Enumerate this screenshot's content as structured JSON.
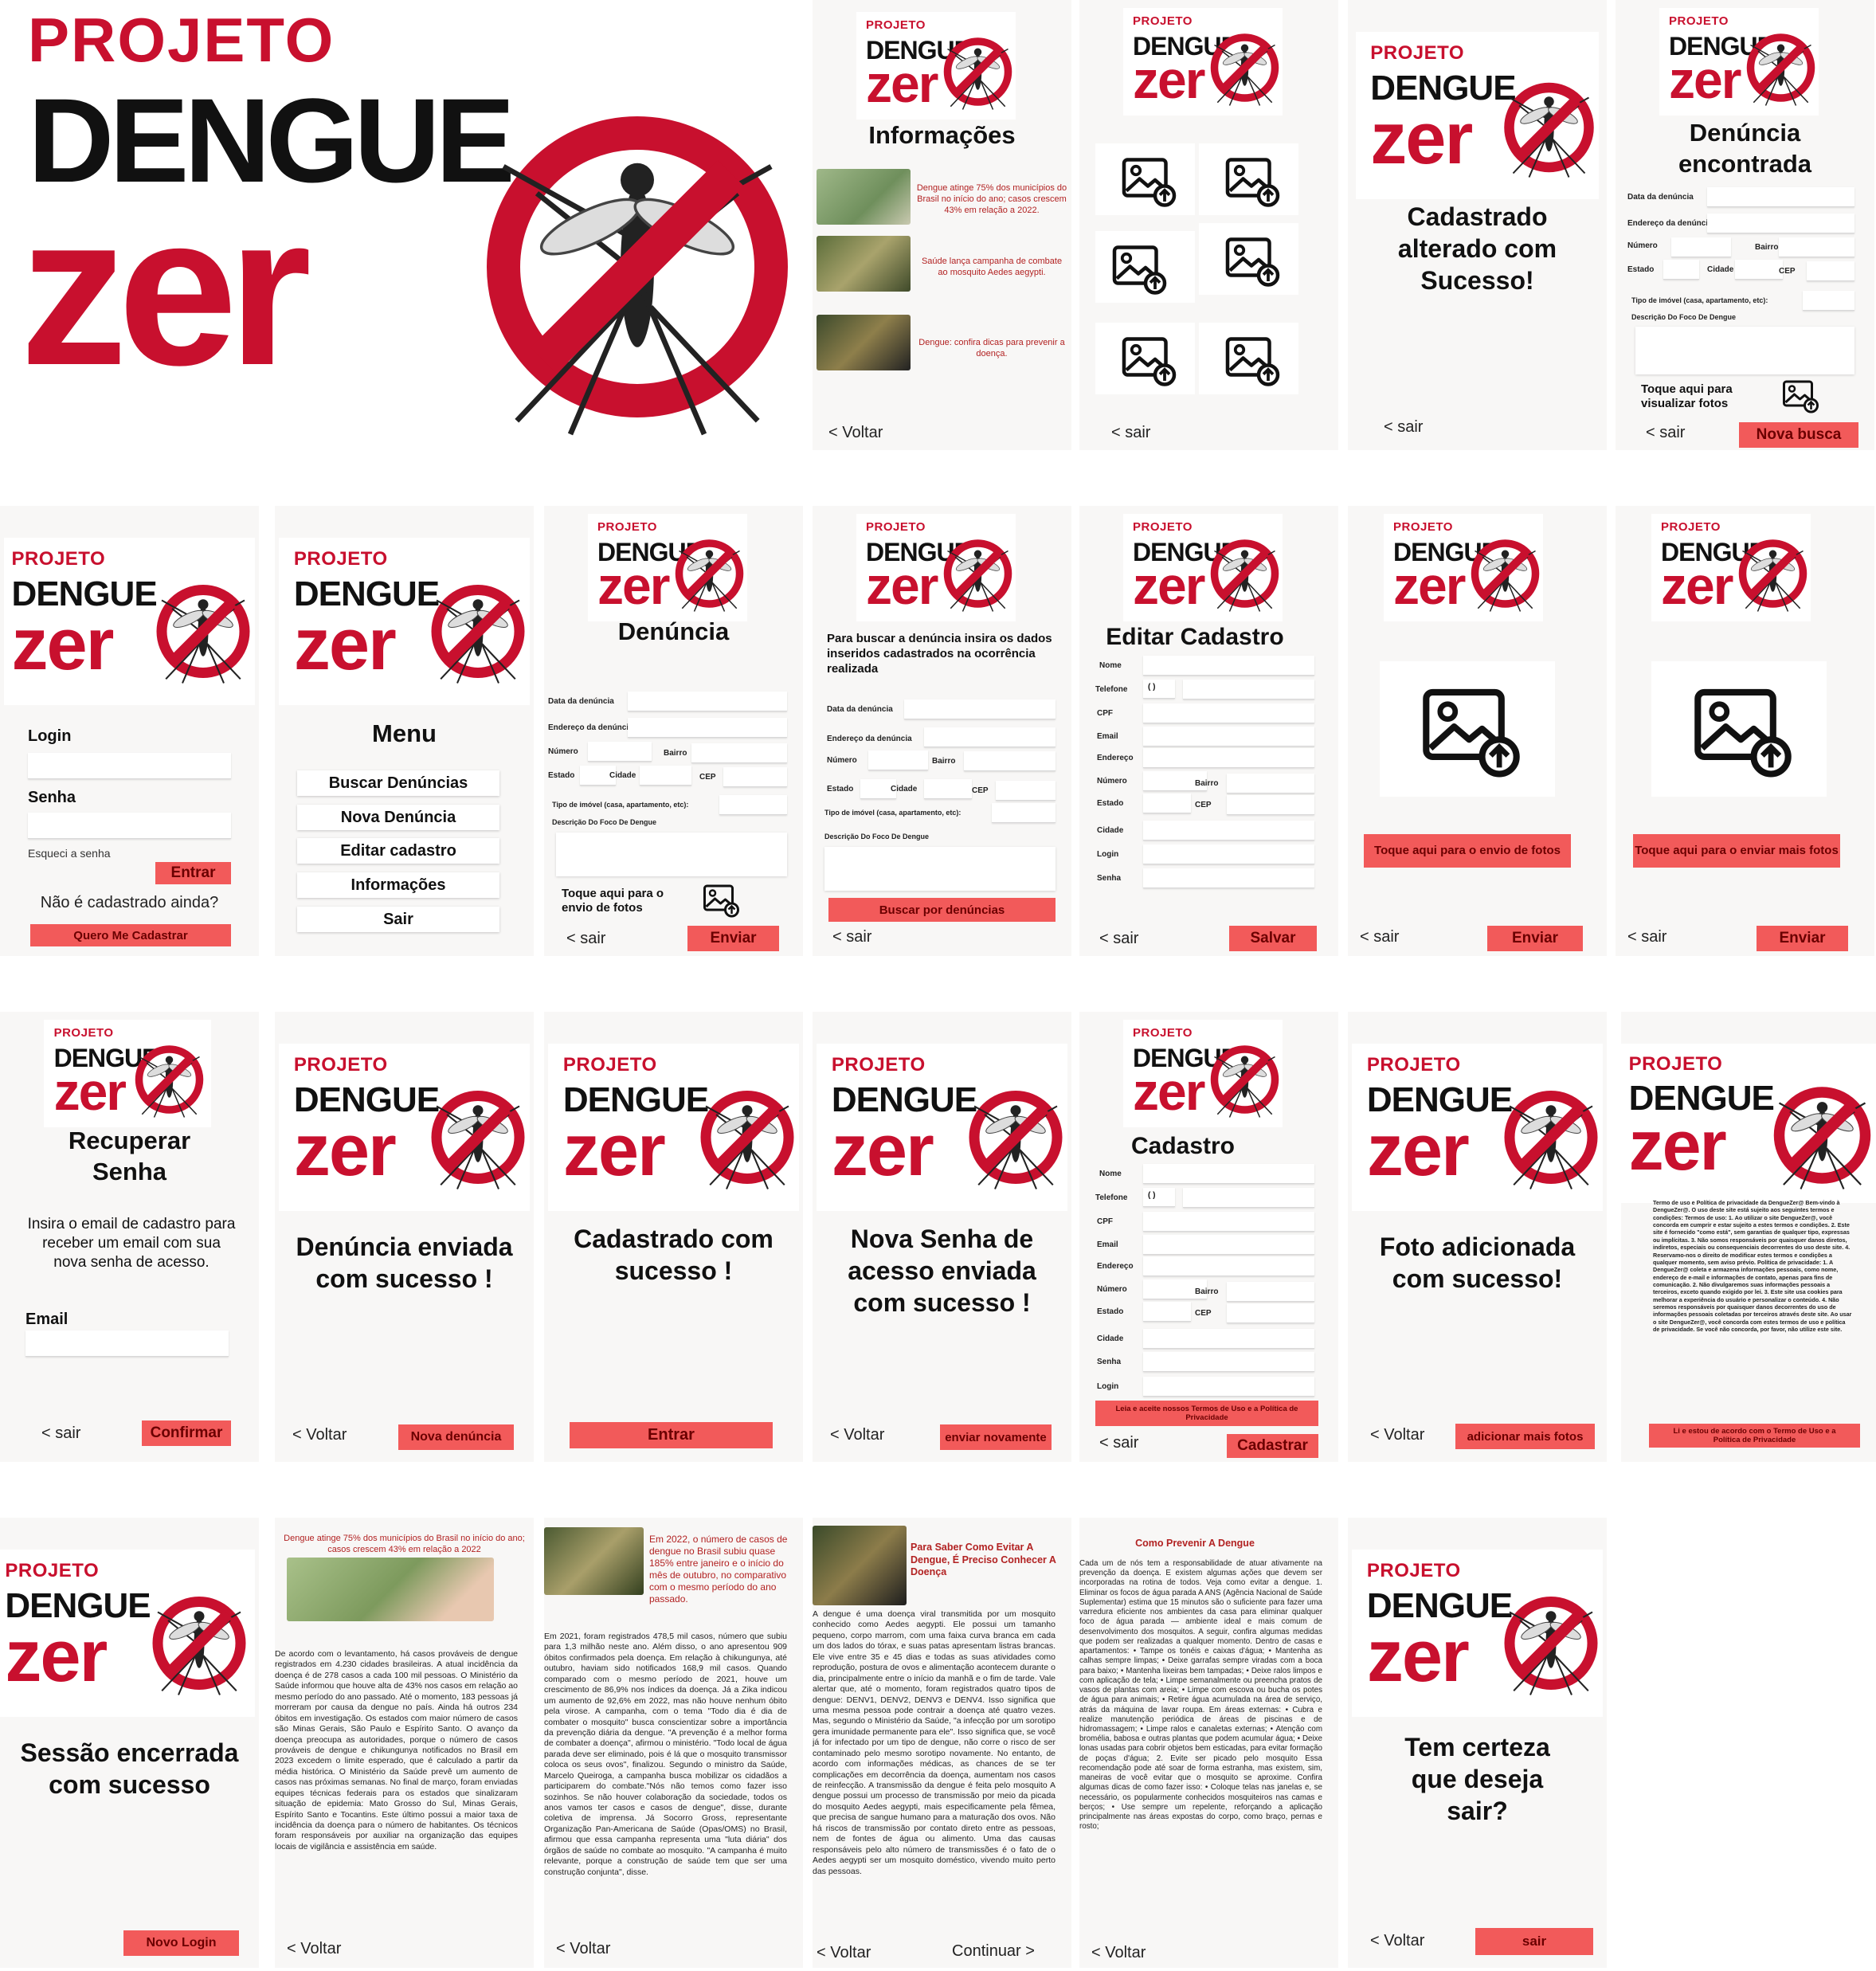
{
  "brand": {
    "projeto": "PROJETO",
    "dengue": "DENGUE",
    "zero": "zer"
  },
  "colors": {
    "red": "#c8102e",
    "button": "#f25a5a",
    "background": "#f8f7f6"
  },
  "icons": [
    "mosquito-prohibited-icon",
    "image-upload-icon"
  ],
  "common": {
    "voltar": "< Voltar",
    "sair": "< sair",
    "continuar": "Continuar >"
  },
  "info": {
    "title": "Informações",
    "news": [
      "Dengue atinge 75% dos municípios do Brasil no início do ano; casos crescem 43% em relação a 2022.",
      "Saúde lança campanha de combate ao mosquito Aedes aegypti.",
      "Dengue: confira dicas para prevenir a doença."
    ]
  },
  "cadastro_alterado": {
    "message": "Cadastrado alterado com Sucesso!"
  },
  "denuncia_encontrada": {
    "title": "Denúncia encontrada",
    "photos_label": "Toque aqui para visualizar fotos",
    "nova_busca": "Nova busca"
  },
  "fields": {
    "data": "Data da denúncia",
    "endereco": "Endereço da denúncia",
    "numero": "Número",
    "bairro": "Bairro",
    "estado": "Estado",
    "cidade": "Cidade",
    "cep": "CEP",
    "tipo": "Tipo de imóvel (casa, apartamento, etc):",
    "descricao": "Descrição Do Foco De Dengue"
  },
  "login": {
    "login": "Login",
    "senha": "Senha",
    "esqueci": "Esqueci a senha",
    "entrar": "Entrar",
    "nao_cadastrado": "Não é cadastrado ainda?",
    "quero": "Quero Me Cadastrar"
  },
  "menu": {
    "title": "Menu",
    "items": [
      "Buscar Denúncias",
      "Nova Denúncia",
      "Editar cadastro",
      "Informações",
      "Sair"
    ]
  },
  "denuncia": {
    "title": "Denúncia",
    "photos_label": "Toque aqui para o envio de fotos",
    "enviar": "Enviar"
  },
  "buscar": {
    "intro": "Para buscar a denúncia insira os dados inseridos cadastrados na ocorrência realizada",
    "button": "Buscar por denúncias"
  },
  "editar": {
    "title": "Editar Cadastro",
    "fields": [
      "Nome",
      "Telefone",
      "CPF",
      "Email",
      "Endereço",
      "Número",
      "Bairro",
      "Estado",
      "CEP",
      "Cidade",
      "Login",
      "Senha"
    ],
    "phone": "(      )",
    "salvar": "Salvar"
  },
  "upload1": {
    "label": "Toque aqui para o envio de fotos",
    "enviar": "Enviar"
  },
  "upload2": {
    "label": "Toque aqui para o enviar mais fotos",
    "enviar": "Enviar"
  },
  "recuperar": {
    "title": "Recuperar Senha",
    "text": "Insira o email de cadastro para receber um email com sua nova senha de acesso.",
    "email": "Email",
    "confirmar": "Confirmar"
  },
  "denuncia_enviada": {
    "message": "Denúncia enviada com sucesso !",
    "nova": "Nova denúncia"
  },
  "cadastrado": {
    "message": "Cadastrado com sucesso !",
    "entrar": "Entrar"
  },
  "nova_senha": {
    "message": "Nova Senha de acesso enviada com sucesso !",
    "enviar": "enviar novamente"
  },
  "cadastro": {
    "title": "Cadastro",
    "terms": "Leia e aceite  nossos Termos de Uso e a Política de Privacidade",
    "cadastrar": "Cadastrar"
  },
  "foto_adicionada": {
    "message": "Foto adicionada com sucesso!",
    "mais": "adicionar mais fotos"
  },
  "termos": {
    "text": "Termo de uso e Política de privacidade da DengueZer@ Bem-vindo à DengueZer@. O uso deste site está sujeito aos seguintes termos e condições: Termos de uso: 1. Ao utilizar o site DengueZer@, você concorda em cumprir e estar sujeito a estes termos e condições. 2. Este site é fornecido \"como está\", sem garantias de qualquer tipo, expressas ou implícitas. 3. Não somos responsáveis por quaisquer danos diretos, indiretos, especiais ou consequenciais decorrentes do uso deste site. 4. Reservamo-nos o direito de modificar estes termos e condições a qualquer momento, sem aviso prévio. Política de privacidade: 1. A DengueZer@ coleta e armazena informações pessoais, como nome, endereço de e-mail e informações de contato, apenas para fins de comunicação. 2. Não divulgaremos suas informações pessoais a terceiros, exceto quando exigido por lei. 3. Este site usa cookies para melhorar a experiência do usuário e personalizar o conteúdo. 4. Não seremos responsáveis por quaisquer danos decorrentes do uso de informações pessoais coletadas por terceiros através deste site. Ao usar o site DengueZer@, você concorda com estes termos de uso e política de privacidade. Se você não concorda, por favor, não utilize este site.",
    "aceite": "Li e estou de acordo com o Termo de Uso e a Política de Privacidade"
  },
  "sessao": {
    "message": "Sessão encerrada com sucesso",
    "novo": "Novo Login"
  },
  "artigo1": {
    "headline": "Dengue atinge 75% dos municípios do Brasil no início do ano; casos crescem 43% em relação a 2022",
    "body": "De acordo com o levantamento, há casos prováveis de dengue registrados em 4.230 cidades brasileiras. A atual incidência da doença é de 278 casos a cada 100 mil pessoas. O Ministério da Saúde informou que houve alta de 43% nos casos em relação ao mesmo período do ano passado. Até o momento, 183 pessoas já morreram por causa da dengue no país. Ainda há outros 234 óbitos em investigação. Os estados com maior número de casos são Minas Gerais, São Paulo e Espírito Santo. O avanço da doença preocupa as autoridades, porque o número de casos prováveis de dengue e chikungunya notificados no Brasil em 2023 excedem o limite esperado, que é calculado a partir da média histórica. O Ministério da Saúde prevê um aumento de casos nas próximas semanas. No final de março, foram enviadas equipes técnicas federais para os estados que sinalizaram situação de epidemia: Mato Grosso do Sul, Minas Gerais, Espírito Santo e Tocantins. Este último possui a maior taxa de incidência da doença para o número de habitantes. Os técnicos foram responsáveis por auxiliar na organização das equipes locais de vigilância e assistência em saúde."
  },
  "artigo2": {
    "headline": "Em 2022, o número de casos de dengue no Brasil subiu quase 185% entre janeiro e o início do mês de outubro, no comparativo com o mesmo período do ano passado.",
    "body": "Em 2021, foram registrados 478,5 mil casos, número que subiu para 1,3 milhão neste ano. Além disso, o ano apresentou 909 óbitos confirmados pela doença. Em relação à chikungunya, até outubro, haviam sido notificados 168,9 mil casos. Quando comparado com o mesmo período de 2021, houve um crescimento de 86,9% nos índices da doença. Já a Zika indicou um aumento de 92,6% em 2022, mas não houve nenhum óbito pela virose. A campanha, com o tema \"Todo dia é dia de combater o mosquito\" busca conscientizar sobre a importância da prevenção diária da dengue. \"A prevenção é a melhor forma de combater a doença\", afirmou o ministério. \"Todo local de água parada deve ser eliminado, pois é lá que o mosquito transmissor coloca os seus ovos\", finalizou. Segundo o ministro da Saúde, Marcelo Queiroga, a campanha busca mobilizar os cidadãos a participarem do combate.\"Nós não temos como fazer isso sozinhos. Se não houver colaboração da sociedade, todos os anos vamos ter casos e casos de dengue\", disse, durante coletiva de imprensa. Já Socorro Gross, representante Organização Pan-Americana de Saúde (Opas/OMS) no Brasil, afirmou que essa campanha representa uma \"luta diária\" dos órgãos de saúde no combate ao mosquito. \"A campanha é muito relevante, porque a construção de saúde tem que ser uma construção conjunta\", disse."
  },
  "artigo3": {
    "headline": "Para Saber Como Evitar A Dengue, É Preciso Conhecer A Doença",
    "body": "A dengue é uma doença viral transmitida por um mosquito conhecido como Aedes aegypti. Ele possui um tamanho pequeno, corpo marrom, com uma faixa curva branca em cada um dos lados do tórax, e suas patas apresentam listras brancas. Ele vive entre 35 e 45 dias e todas as suas atividades como reprodução, postura de ovos e alimentação acontecem durante o dia, principalmente entre o início da manhã e o fim de tarde. Vale alertar que, até o momento, foram registrados quatro tipos de dengue: DENV1, DENV2, DENV3 e DENV4. Isso significa que uma mesma pessoa pode contrair a doença até quatro vezes. Mas, segundo o Ministério da Saúde, \"a infecção por um sorotipo gera imunidade permanente para ele\". Isso significa que, se você já for infectado por um tipo de dengue, não corre o risco de ser contaminado pelo mesmo sorotipo novamente. No entanto, de acordo com informações médicas, as chances de se ter complicações em decorrência da doença, aumentam nos casos de reinfecção. A transmissão da dengue é feita pelo mosquito A dengue possui um processo de transmissão por meio da picada do mosquito Aedes aegypti, mais especificamente pela fêmea, que precisa de sangue humano para a maturação dos ovos. Não há riscos de transmissão por contato direto entre as pessoas, nem de fontes de água ou alimento. Uma das causas responsáveis pelo alto número de transmissões é o fato de o Aedes aegypti ser um mosquito doméstico, vivendo muito perto das pessoas."
  },
  "artigo4": {
    "headline": "Como Prevenir A Dengue",
    "body": "Cada um de nós tem a responsabilidade de atuar ativamente na prevenção da doença. E existem algumas ações que devem ser incorporadas na rotina de todos. Veja como evitar a dengue. 1. Eliminar os focos de água parada A ANS (Agência Nacional de Saúde Suplementar) estima que 15 minutos são o suficiente para fazer uma varredura eficiente nos ambientes da casa para eliminar qualquer foco de água parada — ambiente ideal e mais comum de desenvolvimento dos mosquitos. A seguir, confira algumas medidas que podem ser realizadas a qualquer momento. Dentro de casas e apartamentos: • Tampe os tonéis e caixas d'água; • Mantenha as calhas sempre limpas; • Deixe garrafas sempre viradas com a boca para baixo; • Mantenha lixeiras bem tampadas; • Deixe ralos limpos e com aplicação de tela; • Limpe semanalmente ou preencha pratos de vasos de plantas com areia; • Limpe com escova ou bucha os potes de água para animais; • Retire água acumulada na área de serviço, atrás da máquina de lavar roupa. Em áreas externas: • Cubra e realize manutenção periódica de áreas de piscinas e de hidromassagem; • Limpe ralos e canaletas externas; • Atenção com bromélia, babosa e outras plantas que podem acumular água; • Deixe lonas usadas para cobrir objetos bem esticadas, para evitar formação de poças d'água; 2. Evite ser picado pelo mosquito Essa recomendação pode até soar de forma estranha, mas existem, sim, maneiras de você evitar que o mosquito se aproxime. Confira algumas dicas de como fazer isso: • Coloque telas nas janelas e, se necessário, os popularmente conhecidos mosquiteiros nas camas e berços; • Use sempre um repelente, reforçando a aplicação principalmente nas áreas expostas do corpo, como braço, pernas e rosto;"
  },
  "confirmar_sair": {
    "message": "Tem certeza que deseja sair?",
    "sair": "sair"
  }
}
